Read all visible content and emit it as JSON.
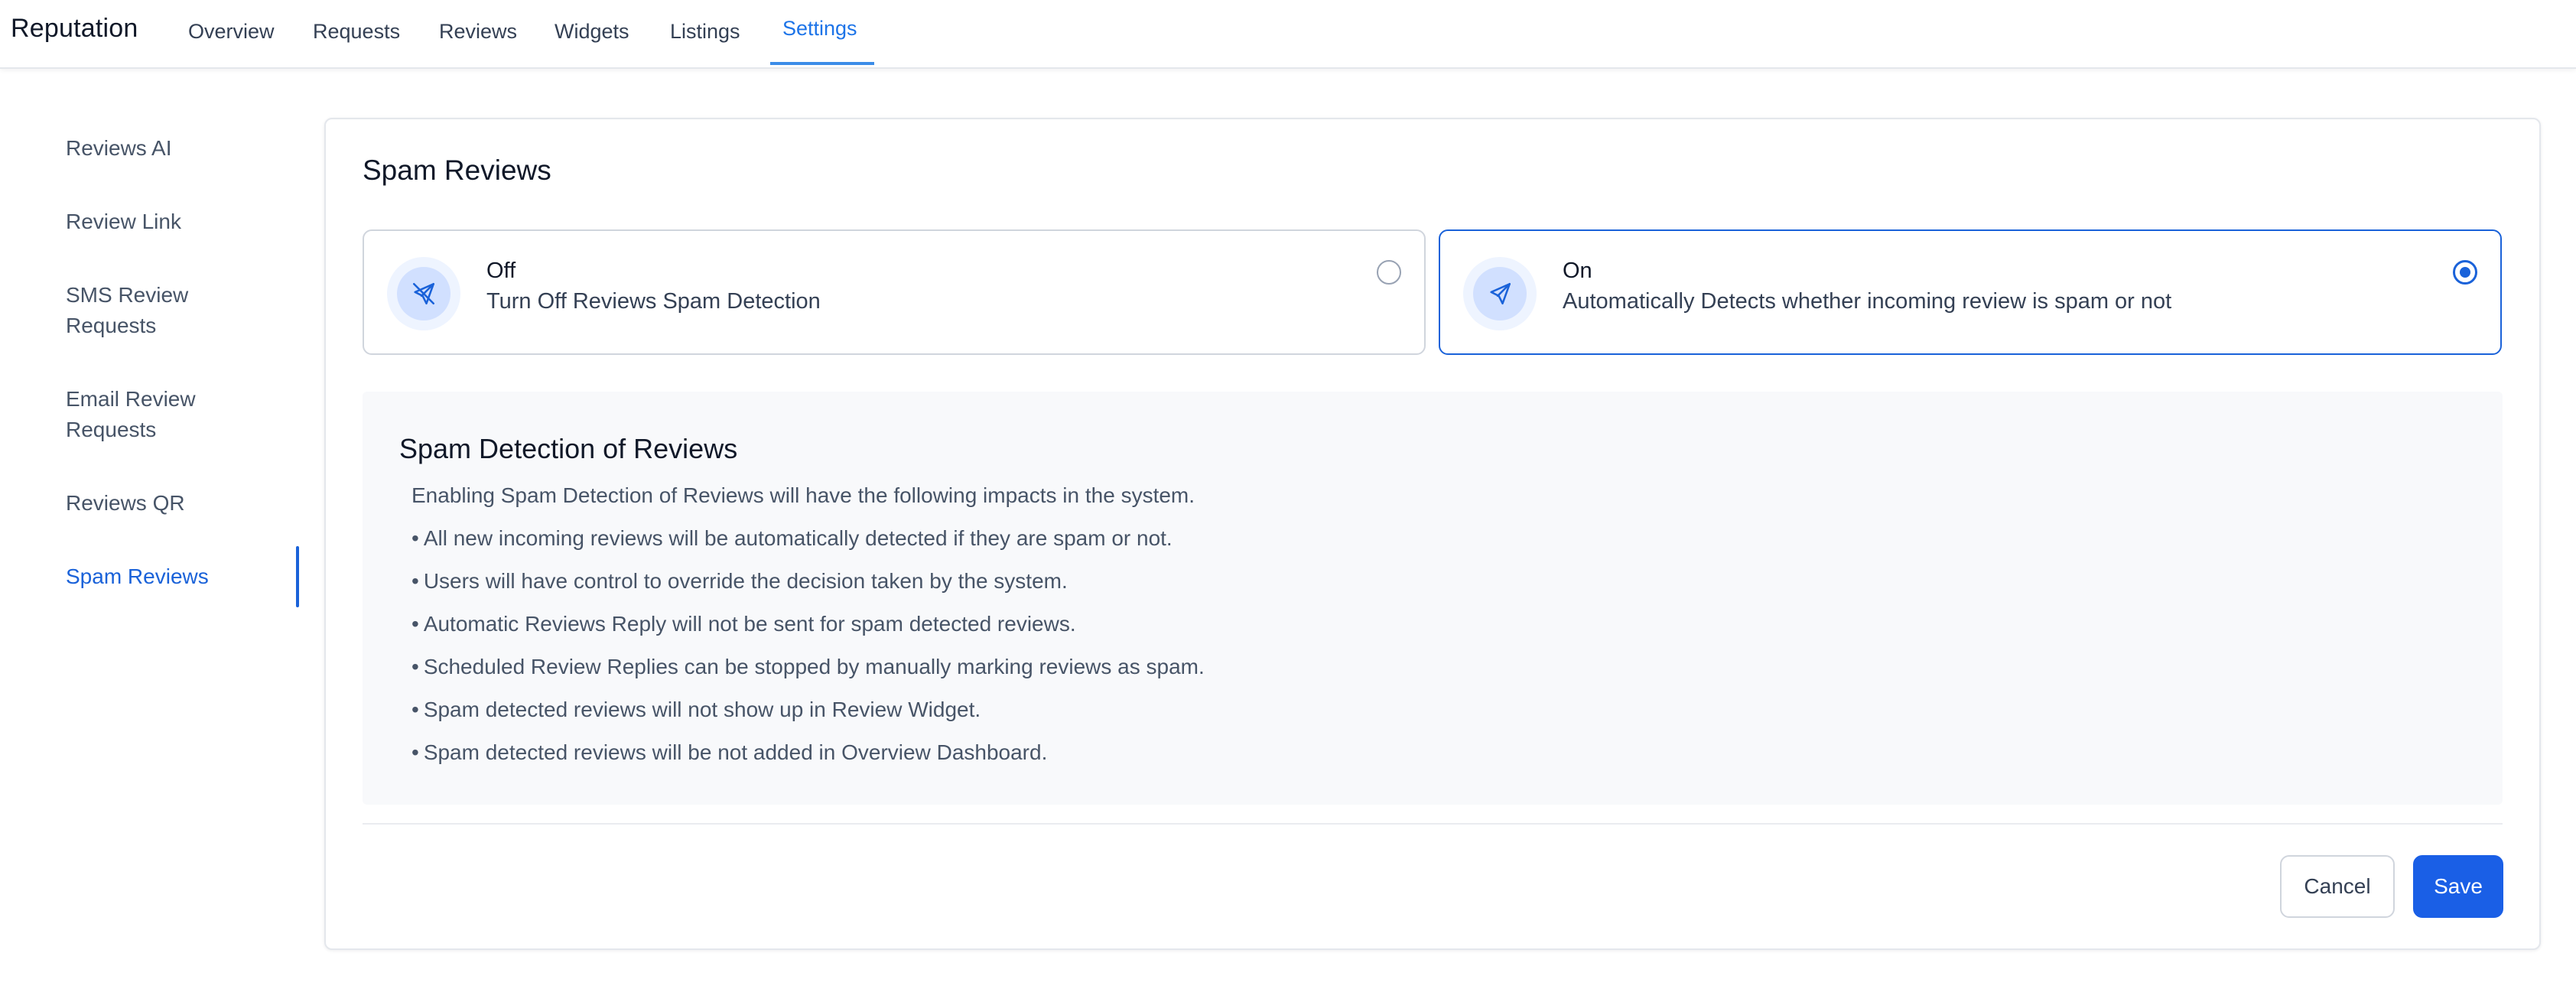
{
  "app": {
    "title": "Reputation"
  },
  "nav": {
    "tabs": [
      {
        "label": "Overview"
      },
      {
        "label": "Requests"
      },
      {
        "label": "Reviews"
      },
      {
        "label": "Widgets"
      },
      {
        "label": "Listings"
      },
      {
        "label": "Settings"
      }
    ],
    "active": "Settings"
  },
  "sidebar": {
    "items": [
      {
        "label": "Reviews AI"
      },
      {
        "label": "Review Link"
      },
      {
        "label": "SMS Review\nRequests"
      },
      {
        "label": "Email Review\nRequests"
      },
      {
        "label": "Reviews QR"
      },
      {
        "label": "Spam Reviews"
      }
    ],
    "active": "Spam Reviews"
  },
  "main": {
    "title": "Spam Reviews",
    "options": [
      {
        "label": "Off",
        "description": "Turn Off Reviews Spam Detection",
        "icon": "send-off-icon",
        "selected": false
      },
      {
        "label": "On",
        "description": "Automatically Detects whether incoming review is spam or not",
        "icon": "send-icon",
        "selected": true
      }
    ],
    "info": {
      "title": "Spam Detection of Reviews",
      "intro": "Enabling Spam Detection of Reviews will have the following impacts in the system.",
      "bullets": [
        "All new incoming reviews will be automatically detected if they are spam or not.",
        "Users will have control to override the decision taken by the system.",
        "Automatic Reviews Reply will not be sent for spam detected reviews.",
        "Scheduled Review Replies can be stopped by manually marking reviews as spam.",
        "Spam detected reviews will not show up in Review Widget.",
        "Spam detected reviews will be not added in Overview Dashboard."
      ]
    },
    "actions": {
      "cancel_label": "Cancel",
      "save_label": "Save"
    }
  },
  "colors": {
    "accent": "#1a62d9",
    "primary_button": "#1a5fe6",
    "nav_active": "#1d74e8",
    "panel_background": "#f8f9fb"
  }
}
